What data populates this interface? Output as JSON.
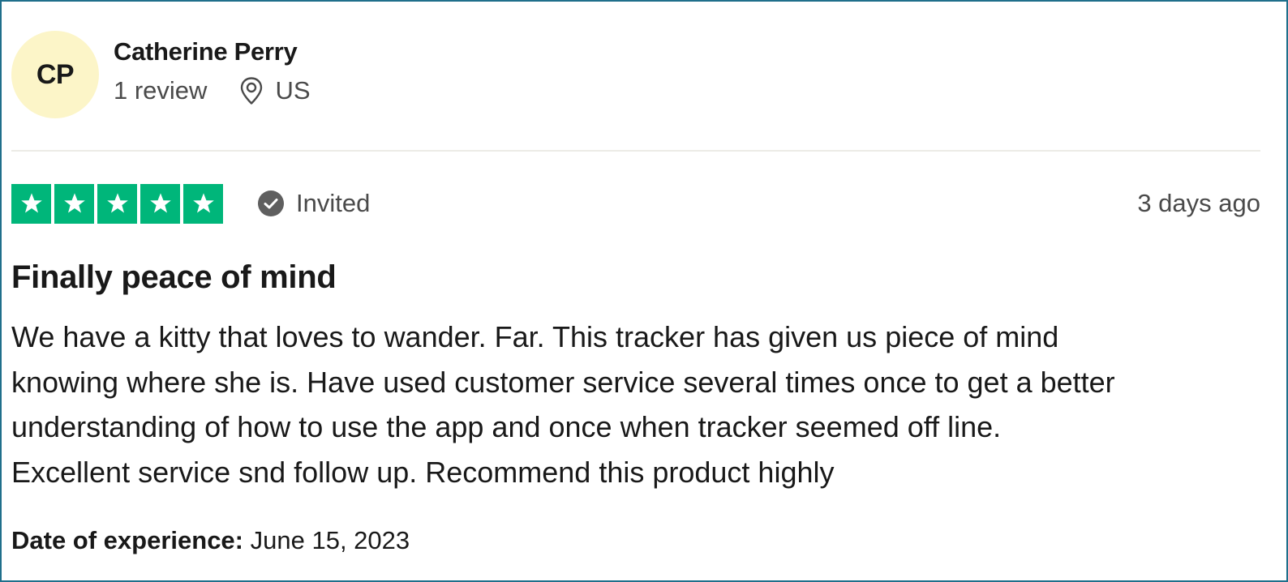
{
  "reviewer": {
    "initials": "CP",
    "name": "Catherine Perry",
    "review_count": "1 review",
    "location": "US",
    "avatar_color": "#fcf5c8"
  },
  "rating": {
    "stars": 5,
    "max_stars": 5,
    "star_color": "#00b67a",
    "badge_label": "Invited",
    "posted": "3 days ago"
  },
  "review": {
    "title": "Finally peace of mind",
    "body_lines": [
      "We have a kitty that loves to wander. Far. This tracker has given us piece of mind",
      "knowing where she is. Have used customer service several times once to get a better",
      "understanding of how to use the app and once when tracker seemed off line.",
      "Excellent service snd follow up. Recommend this product highly"
    ]
  },
  "experience": {
    "label": "Date of experience:",
    "date": "June 15, 2023"
  },
  "icons": {
    "location": "location-pin-icon",
    "badge": "check-circle-icon",
    "star": "star-icon"
  },
  "colors": {
    "frame_border": "#1f6f8b",
    "text_primary": "#191919",
    "text_secondary": "#4a4a4a",
    "divider": "#ecebe6"
  }
}
